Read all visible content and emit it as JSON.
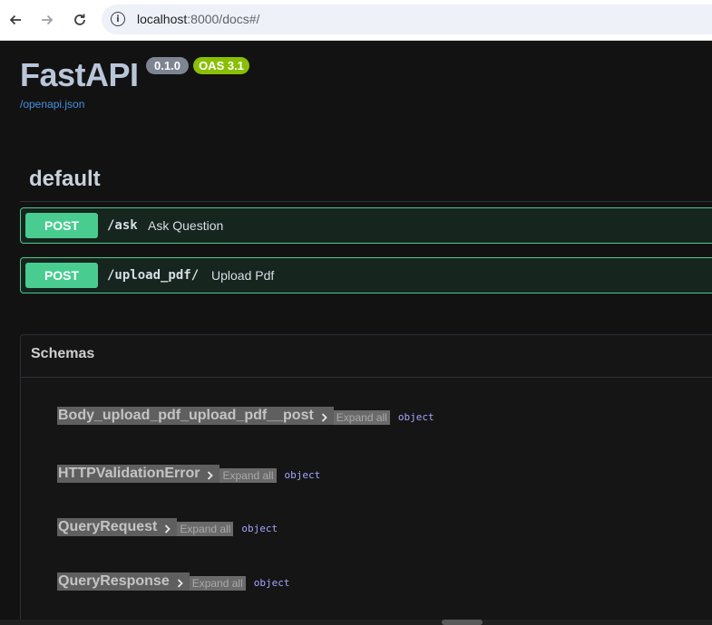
{
  "browser": {
    "url_host": "localhost",
    "url_rest": ":8000/docs#/"
  },
  "header": {
    "title": "FastAPI",
    "version": "0.1.0",
    "oas": "OAS 3.1",
    "spec_link": "/openapi.json"
  },
  "tag": {
    "name": "default",
    "operations": [
      {
        "method": "POST",
        "path": "/ask",
        "summary": "Ask Question"
      },
      {
        "method": "POST",
        "path": "/upload_pdf/",
        "summary": "Upload Pdf"
      }
    ]
  },
  "schemas": {
    "title": "Schemas",
    "expand_label": "Expand all",
    "models": [
      {
        "name": "Body_upload_pdf_upload_pdf__post",
        "type": "object"
      },
      {
        "name": "HTTPValidationError",
        "type": "object"
      },
      {
        "name": "QueryRequest",
        "type": "object"
      },
      {
        "name": "QueryResponse",
        "type": "object"
      }
    ]
  },
  "colors": {
    "post_green": "#49cc90",
    "oas_badge": "#89bf04",
    "version_badge": "#7d8492",
    "link_blue": "#4990e2"
  }
}
